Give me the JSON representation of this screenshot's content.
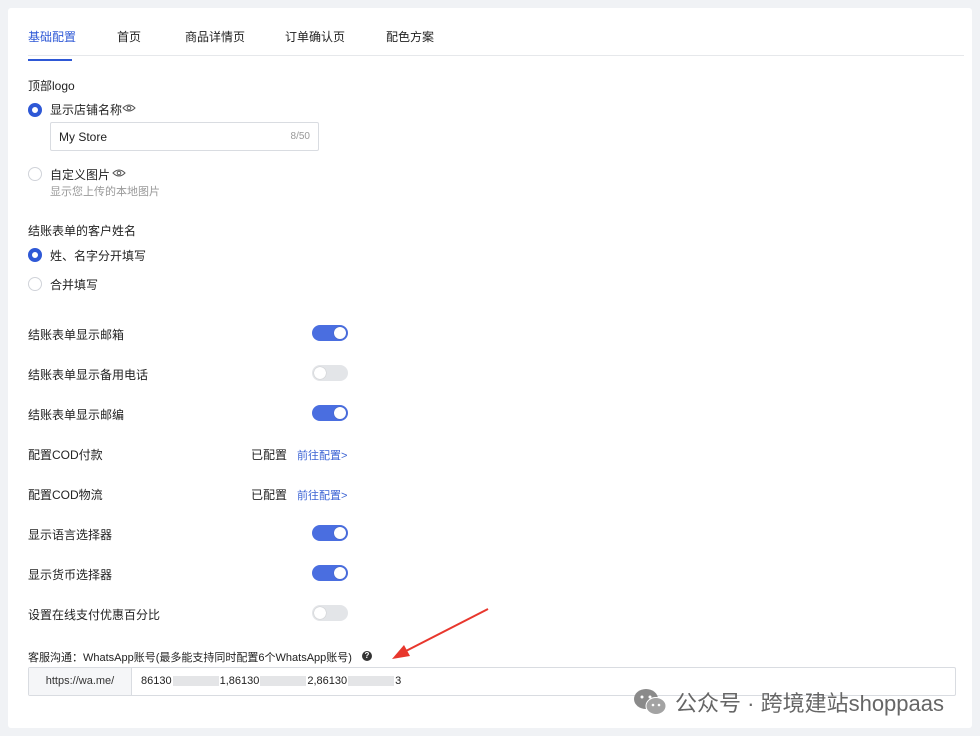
{
  "tabs": [
    {
      "label": "基础配置",
      "active": true
    },
    {
      "label": "首页"
    },
    {
      "label": "商品详情页"
    },
    {
      "label": "订单确认页"
    },
    {
      "label": "配色方案"
    }
  ],
  "logo": {
    "section_label": "顶部logo",
    "option_store_name": "显示店铺名称",
    "store_name_value": "My Store",
    "store_name_counter": "8/50",
    "option_custom_image": "自定义图片",
    "custom_image_hint": "显示您上传的本地图片"
  },
  "customer_name": {
    "section_label": "结账表单的客户姓名",
    "option_split": "姓、名字分开填写",
    "option_merged": "合并填写"
  },
  "settings": [
    {
      "label": "结账表单显示邮箱",
      "type": "toggle",
      "on": true
    },
    {
      "label": "结账表单显示备用电话",
      "type": "toggle",
      "on": false
    },
    {
      "label": "结账表单显示邮编",
      "type": "toggle",
      "on": true
    },
    {
      "label": "配置COD付款",
      "type": "link",
      "status": "已配置",
      "link": "前往配置>"
    },
    {
      "label": "配置COD物流",
      "type": "link",
      "status": "已配置",
      "link": "前往配置>"
    },
    {
      "label": "显示语言选择器",
      "type": "toggle",
      "on": true
    },
    {
      "label": "显示货币选择器",
      "type": "toggle",
      "on": true
    },
    {
      "label": "设置在线支付优惠百分比",
      "type": "toggle",
      "on": false
    }
  ],
  "whatsapp": {
    "label": "客服沟通：WhatsApp账号(最多能支持同时配置6个WhatsApp账号)",
    "help_glyph": "?",
    "prefix": "https://wa.me/",
    "value_parts": [
      "86130",
      "1,86130",
      "2,86130",
      "3"
    ]
  },
  "watermark": {
    "text": "公众号 · 跨境建站shoppaas"
  },
  "colors": {
    "accent": "#2e58d6",
    "toggle_on": "#4a6ee0",
    "toggle_off": "#e3e5e8",
    "link": "#3b63d4",
    "annotation_arrow": "#e8372d"
  }
}
